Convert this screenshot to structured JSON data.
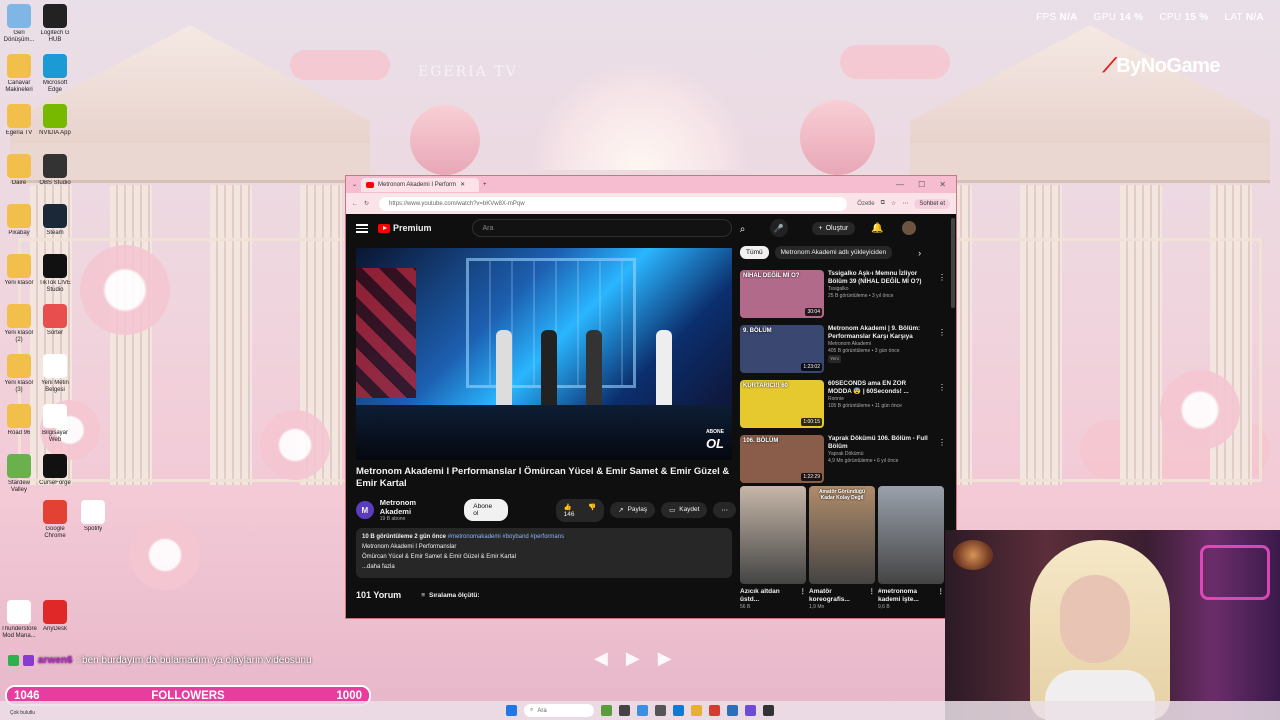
{
  "system_stats": {
    "fps_label": "FPS",
    "fps_value": "N/A",
    "gpu_label": "GPU",
    "gpu_value": "14 %",
    "cpu_label": "CPU",
    "cpu_value": "15 %",
    "lat_label": "LAT",
    "lat_value": "N/A"
  },
  "brand": "ByNoGame",
  "watermark": "EGERIA TV",
  "desktop_icons": [
    {
      "label": "Geri Dönüşüm..."
    },
    {
      "label": "Logitech G HUB"
    },
    {
      "label": "Canavar Makineleri"
    },
    {
      "label": "Microsoft Edge"
    },
    {
      "label": "Egeria TV"
    },
    {
      "label": "NVIDIA App"
    },
    {
      "label": "Daire"
    },
    {
      "label": "OBS Studio"
    },
    {
      "label": "Pixabay"
    },
    {
      "label": "Steam"
    },
    {
      "label": "Yeni klasör"
    },
    {
      "label": "TikTok LIVE Studio"
    },
    {
      "label": "Yeni klasör (2)"
    },
    {
      "label": "Sorter"
    },
    {
      "label": "Yeni klasör (3)"
    },
    {
      "label": "Yeni Metin Belgesi"
    },
    {
      "label": "Road 96"
    },
    {
      "label": "Bilgisayar Web"
    },
    {
      "label": "Stardew Valley"
    },
    {
      "label": "CurseForge"
    },
    {
      "label": "Google Chrome"
    },
    {
      "label": "Spotify"
    },
    {
      "label": "Thunderstore Mod Mana..."
    },
    {
      "label": "AnyDesk"
    }
  ],
  "browser": {
    "tab_title": "Metronom Akademi I Perform",
    "new_tab": "+",
    "url": "https://www.youtube.com/watch?v=bKVw8X-mPqw",
    "summarize": "Özetle",
    "chat": "Sohbet et",
    "win_min": "—",
    "win_max": "☐",
    "win_close": "✕"
  },
  "youtube": {
    "logo": "Premium",
    "search_placeholder": "Ara",
    "create": "Oluştur",
    "video_title": "Metronom Akademi I Performanslar I Ömürcan Yücel & Emir Samet & Emir Güzel & Emir Kartal",
    "channel_name": "Metronom Akademi",
    "channel_subs": "19 B abone",
    "subscribe": "Abone ol",
    "likes": "146",
    "share": "Paylaş",
    "save": "Kaydet",
    "overlay_text": "ABONE",
    "overlay_big": "OL",
    "description": {
      "line1_stats": "10 B görüntüleme  2 gün önce",
      "line1_tags": "#metronomakademi #boyband #performans",
      "line2": "Metronom Akademi I Performanslar",
      "line3": "Ömürcan Yücel & Emir Samet & Emir Güzel & Emir Kartal",
      "more": "...daha fazla"
    },
    "comments_count": "101 Yorum",
    "sort": "Sıralama ölçütü:",
    "chips": [
      "Tümü",
      "Metronom Akademi adlı yükleyiciden"
    ],
    "chip_next": "›",
    "sidebar": [
      {
        "title": "Tssigalko Aşk-ı Memnu İzliyor Bölüm 39 (NİHAL DEĞİL Mİ O?)",
        "channel": "Tssigalko",
        "meta": "25 B görüntüleme • 3 yıl önce",
        "duration": "30:04",
        "thumb_text": "NİHAL DEĞİL Mİ O?",
        "color": "#b26a8a"
      },
      {
        "title": "Metronom Akademi | 9. Bölüm: Performanslar Karşı Karşıya",
        "channel": "Metronom Akademi",
        "meta": "405 B görüntüleme • 3 gün önce",
        "badge": "Yeni",
        "duration": "1:23:02",
        "thumb_text": "9. BÖLÜM",
        "color": "#3a4770"
      },
      {
        "title": "60SECONDS ama EN ZOR MODDA 😨 | 60Seconds! ...",
        "channel": "Ronnie",
        "meta": "105 B görüntüleme • 11 gün önce",
        "duration": "1:00:15",
        "thumb_text": "KURTARICI!! 60",
        "color": "#e5c92e"
      },
      {
        "title": "Yaprak Dökümü 106. Bölüm - Full Bölüm",
        "channel": "Yaprak Dökümü",
        "meta": "4,9 Mn görüntüleme • 6 yıl önce",
        "duration": "1:22:29",
        "thumb_text": "106. BÖLÜM",
        "color": "#8a5d4a"
      }
    ],
    "shorts": [
      {
        "title": "Azıcık altdan üstd...",
        "views": "56 B",
        "color": "#c7b7a9"
      },
      {
        "title": "Amatör koreografis...",
        "views": "1,9 Mn",
        "color": "#b08c6a",
        "overlay": "Amatör Göründüğü Kadar Kolay Değil"
      },
      {
        "title": "#metronoma kademi işte...",
        "views": "9,6 B",
        "color": "#9aa1ac"
      }
    ]
  },
  "stream": {
    "chat_user": "arwen6",
    "chat_text": ": ben burdayım da bulamadım ya olayların videosunu",
    "followers_current": "1046",
    "followers_label": "FOLLOWERS",
    "followers_goal": "1000",
    "followers_progress": 1.0,
    "media_prev": "◀",
    "media_play": "▶",
    "media_next": "▶"
  },
  "taskbar": {
    "search_placeholder": "Ara",
    "label": "Çok bulutlu"
  }
}
